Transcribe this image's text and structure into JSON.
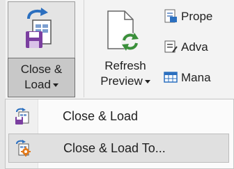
{
  "ribbon": {
    "close_load": {
      "line1": "Close &",
      "line2": "Load",
      "icon": "close-and-load-icon"
    },
    "refresh": {
      "line1": "Refresh",
      "line2": "Preview",
      "icon": "refresh-preview-icon"
    },
    "small_items": [
      {
        "label": "Prope",
        "icon": "properties-icon"
      },
      {
        "label": "Adva",
        "icon": "advanced-editor-icon"
      },
      {
        "label": "Mana",
        "icon": "manage-icon"
      }
    ]
  },
  "menu": {
    "items": [
      {
        "label": "Close & Load",
        "icon": "close-and-load-icon",
        "highlighted": false
      },
      {
        "label": "Close & Load To...",
        "icon": "close-and-load-to-icon",
        "highlighted": true
      }
    ]
  },
  "colors": {
    "ribbon_bg": "#f3f3f3",
    "pressed_bg": "#c8c8c8",
    "menu_bg": "#fbfbfb",
    "highlight_bg": "#e0e0e0",
    "accent_purple": "#7b3fa0",
    "accent_green": "#3a8f3a",
    "accent_blue": "#2b6fbf",
    "accent_orange": "#e27a1c"
  }
}
